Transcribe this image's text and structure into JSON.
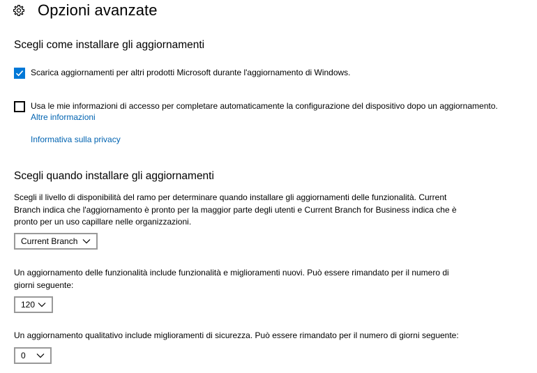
{
  "header": {
    "title": "Opzioni avanzate",
    "icon": "gear-icon"
  },
  "install_section": {
    "title": "Scegli come installare gli aggiornamenti",
    "checkbox_microsoft": {
      "label": "Scarica aggiornamenti per altri prodotti Microsoft durante l'aggiornamento di Windows.",
      "checked": true
    },
    "checkbox_signin": {
      "label": "Usa le mie informazioni di accesso per completare automaticamente la configurazione del dispositivo dopo un aggiornamento.",
      "checked": false
    },
    "more_info_link": "Altre informazioni",
    "privacy_link": "Informativa sulla privacy"
  },
  "when_section": {
    "title": "Scegli quando installare gli aggiornamenti",
    "branch_description": {
      "line1": "Scegli il livello di disponibilità del ramo per determinare quando installare gli aggiornamenti delle funzionalità. Current",
      "line2": "Branch indica che l'aggiornamento è pronto per la maggior parte degli utenti e Current Branch for Business indica che è",
      "line3": "pronto per un uso capillare nelle organizzazioni."
    },
    "branch_select": {
      "value": "Current Branch"
    },
    "feature_description": {
      "line1": "Un aggiornamento delle funzionalità include funzionalità e miglioramenti nuovi. Può essere rimandato per il numero di",
      "line2": "giorni seguente:"
    },
    "feature_defer_select": {
      "value": "120"
    },
    "quality_description": "Un aggiornamento qualitativo include miglioramenti di sicurezza. Può essere rimandato per il numero di giorni seguente:",
    "quality_defer_select": {
      "value": "0"
    }
  },
  "colors": {
    "accent": "#0078d7",
    "link": "#0063b1",
    "select_border": "#999999"
  }
}
